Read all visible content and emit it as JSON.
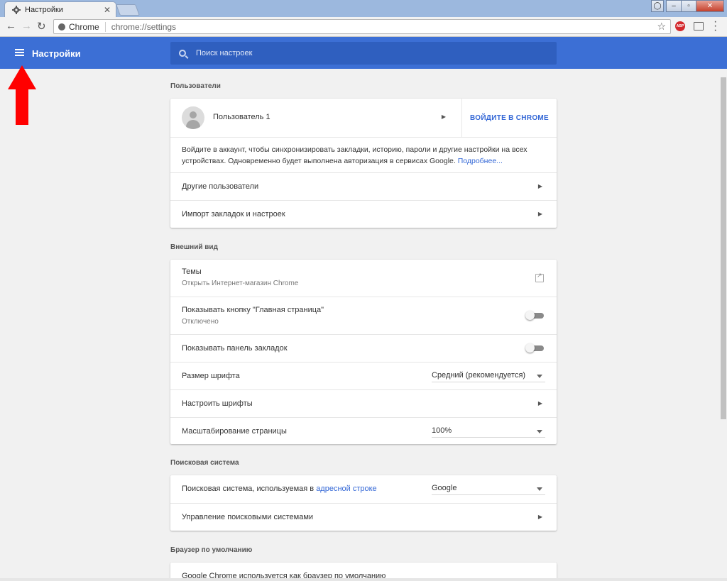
{
  "browser": {
    "tab_title": "Настройки",
    "tab_close": "✕",
    "omnibox_chip": "Chrome",
    "omnibox_url": "chrome://settings",
    "abp_label": "ABP"
  },
  "header": {
    "title": "Настройки",
    "search_placeholder": "Поиск настроек"
  },
  "sections": {
    "users": {
      "title": "Пользователи",
      "profile_name": "Пользователь 1",
      "signin_button": "ВОЙДИТЕ В CHROME",
      "signin_text": "Войдите в аккаунт, чтобы синхронизировать закладки, историю, пароли и другие настройки на всех устройствах. Одновременно будет выполнена авторизация в сервисах Google.",
      "more_link": "Подробнее...",
      "other_users": "Другие пользователи",
      "import": "Импорт закладок и настроек"
    },
    "appearance": {
      "title": "Внешний вид",
      "themes": "Темы",
      "themes_sub": "Открыть Интернет-магазин Chrome",
      "home_button": "Показывать кнопку \"Главная страница\"",
      "home_button_sub": "Отключено",
      "bookmarks_bar": "Показывать панель закладок",
      "font_size": "Размер шрифта",
      "font_size_value": "Средний (рекомендуется)",
      "customize_fonts": "Настроить шрифты",
      "page_zoom": "Масштабирование страницы",
      "page_zoom_value": "100%"
    },
    "search": {
      "title": "Поисковая система",
      "engine_label": "Поисковая система, используемая в",
      "engine_link": "адресной строке",
      "engine_value": "Google",
      "manage": "Управление поисковыми системами"
    },
    "default_browser": {
      "title": "Браузер по умолчанию",
      "status": "Google Chrome используется как браузер по умолчанию"
    }
  },
  "colors": {
    "header_blue": "#3c6fd5",
    "link_blue": "#3367d6",
    "annotation_red": "#ff0000"
  }
}
